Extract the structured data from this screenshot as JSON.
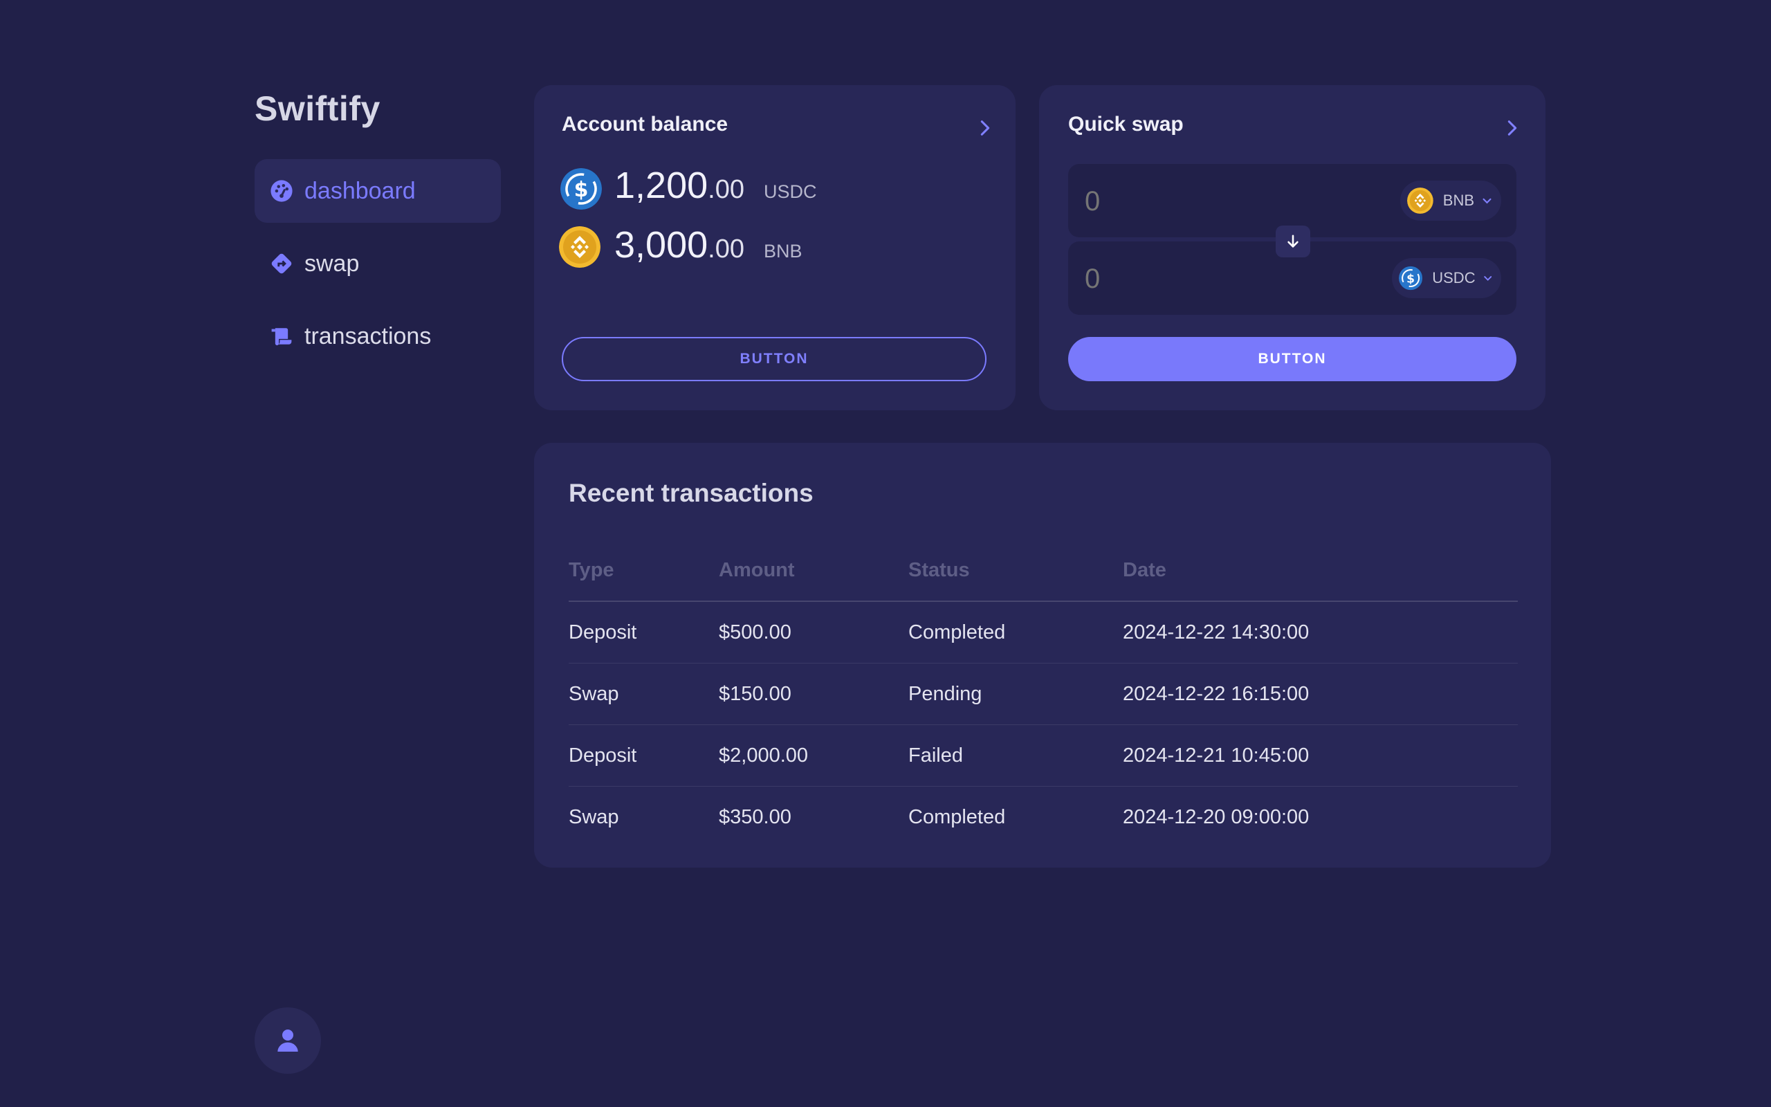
{
  "sidebar": {
    "brand": "Swiftify",
    "items": [
      {
        "label": "dashboard",
        "icon": "dashboard-icon",
        "active": true
      },
      {
        "label": "swap",
        "icon": "swap-icon",
        "active": false
      },
      {
        "label": "transactions",
        "icon": "receipt-icon",
        "active": false
      }
    ],
    "avatar_icon": "user-icon"
  },
  "balance_card": {
    "title": "Account balance",
    "balances": [
      {
        "int": "1,200",
        "dec": ".00",
        "symbol": "USDC",
        "icon": "usdc-coin-icon"
      },
      {
        "int": "3,000",
        "dec": ".00",
        "symbol": "BNB",
        "icon": "bnb-coin-icon"
      }
    ],
    "button_label": "BUTTON"
  },
  "swap_card": {
    "title": "Quick swap",
    "from": {
      "value": "0",
      "token": "BNB",
      "icon": "bnb-coin-icon"
    },
    "to": {
      "value": "0",
      "token": "USDC",
      "icon": "usdc-coin-icon"
    },
    "button_label": "BUTTON"
  },
  "transactions": {
    "title": "Recent transactions",
    "columns": [
      "Type",
      "Amount",
      "Status",
      "Date"
    ],
    "rows": [
      [
        "Deposit",
        "$500.00",
        "Completed",
        "2024-12-22 14:30:00"
      ],
      [
        "Swap",
        "$150.00",
        "Pending",
        "2024-12-22 16:15:00"
      ],
      [
        "Deposit",
        "$2,000.00",
        "Failed",
        "2024-12-21 10:45:00"
      ],
      [
        "Swap",
        "$350.00",
        "Completed",
        "2024-12-20 09:00:00"
      ]
    ]
  },
  "colors": {
    "background": "#212049",
    "card": "#282757",
    "accent": "#7979fb",
    "usdc": "#2775ca",
    "bnb": "#f3ba2f"
  }
}
